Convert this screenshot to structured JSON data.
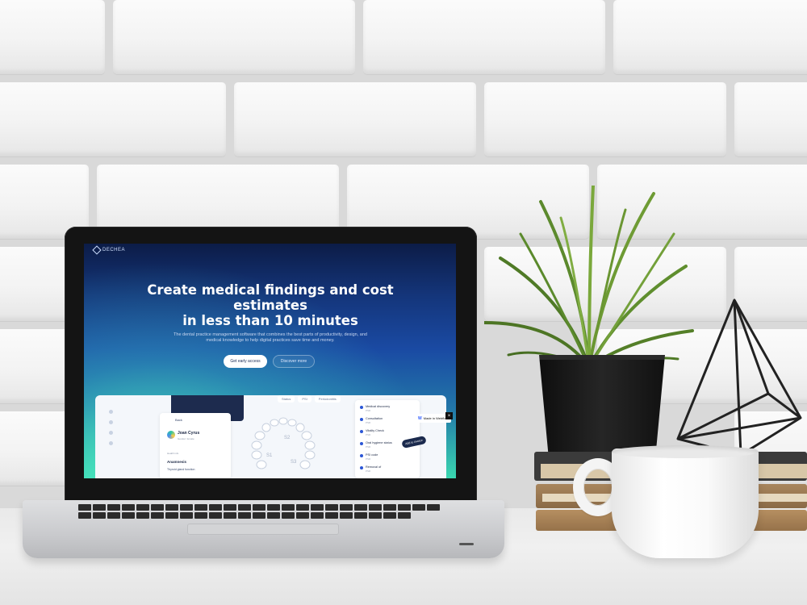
{
  "site": {
    "logo_text": "DECHEA",
    "hero_title_line1": "Create medical findings and cost",
    "hero_title_line2": "estimates",
    "hero_title_line3": "in less than 10 minutes",
    "hero_subtitle_line1": "The dental practice management software that combines the best parts of productivity, design, and",
    "hero_subtitle_line2": "medical knowledge to help digital practices save time and money.",
    "primary_button": "Get early access",
    "secondary_button": "Discover more"
  },
  "app_preview": {
    "back_label": "Back",
    "patient_name": "Joan Cyrus",
    "patient_meta": "Gender: female",
    "health_label": "Health info",
    "anamnesis_label": "Anamnesis",
    "thyroid_label": "Thyroid gland function",
    "tabs": [
      "Status",
      "PSI",
      "Periodontitis"
    ],
    "tooth_labels": [
      "S2",
      "S1",
      "S3"
    ],
    "findings": [
      {
        "title": "Medical discovery",
        "sub": "PSR"
      },
      {
        "title": "Consultation",
        "sub": "PSR"
      },
      {
        "title": "Vitality Check",
        "sub": "PSR"
      },
      {
        "title": "Oral hygiene status",
        "sub": "PSR"
      },
      {
        "title": "PSI code",
        "sub": "PSR"
      },
      {
        "title": "Removal of",
        "sub": "PSR"
      }
    ],
    "add_to_invoice": "Add to invoice",
    "webflow_badge": "Made in Webflow",
    "webflow_mark": "W",
    "close_mark": "×"
  },
  "colors": {
    "hero_top": "#0c1c47",
    "hero_mid": "#1a4aa3",
    "hero_glow": "#3ad7b0",
    "accent": "#2b56d6"
  },
  "icons": {
    "logo": "dechea-logo-icon",
    "avatar": "patient-avatar",
    "check": "finding-check-icon"
  }
}
